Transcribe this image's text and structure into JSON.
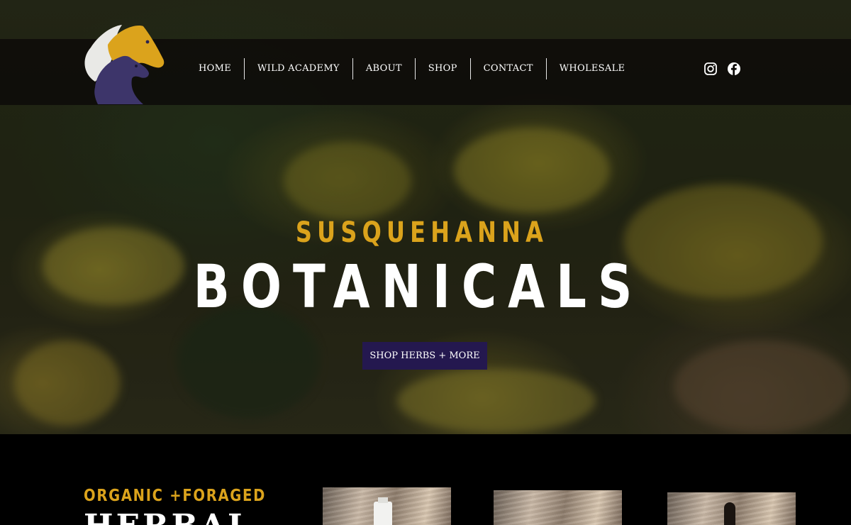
{
  "site": {
    "logo_alt": "Horse head logo"
  },
  "nav": {
    "items": [
      {
        "label": "HOME"
      },
      {
        "label": "WILD ACADEMY"
      },
      {
        "label": "ABOUT"
      },
      {
        "label": "SHOP"
      },
      {
        "label": "CONTACT"
      },
      {
        "label": "WHOLESALE"
      }
    ]
  },
  "social": {
    "icons": [
      "instagram-icon",
      "facebook-icon"
    ]
  },
  "hero": {
    "subtitle": "SUSQUEHANNA",
    "title": "BOTANICALS",
    "cta_label": "SHOP HERBS + MORE"
  },
  "section": {
    "eyebrow": "ORGANIC +FORAGED",
    "heading": "HERBAL"
  },
  "colors": {
    "accent_gold": "#dba31c",
    "cta_purple": "#24184f",
    "header_bg": "#0c0a08",
    "page_bg": "#000000"
  }
}
